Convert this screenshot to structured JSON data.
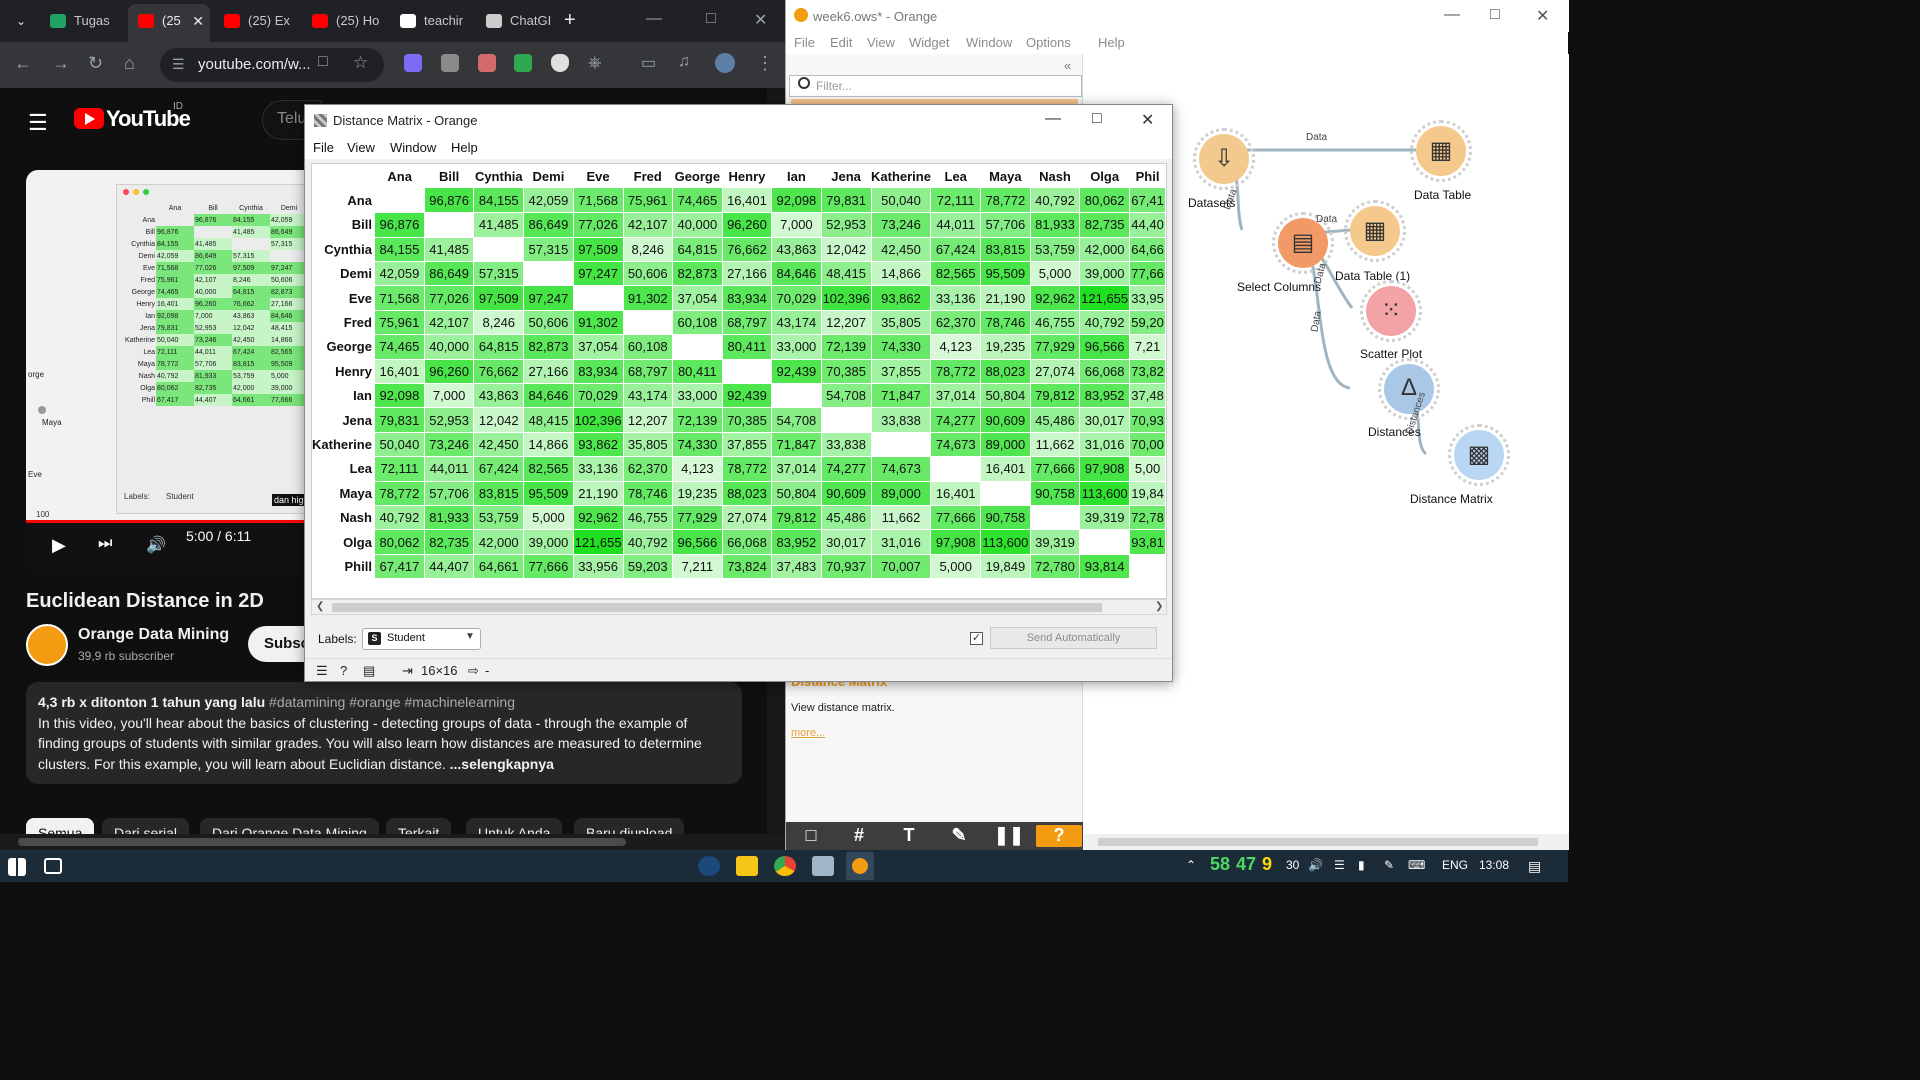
{
  "chrome": {
    "tabs": [
      {
        "label": "Tugas",
        "favicon_color": "#1fa463",
        "active": false
      },
      {
        "label": "(25",
        "favicon_color": "#ff0000",
        "active": true
      },
      {
        "label": "(25) Ex",
        "favicon_color": "#ff0000",
        "active": false
      },
      {
        "label": "(25) Ho",
        "favicon_color": "#ff0000",
        "active": false
      },
      {
        "label": "teachir",
        "favicon_color": "#ffffff",
        "active": false
      },
      {
        "label": "ChatGI",
        "favicon_color": "#cccccc",
        "active": false
      }
    ],
    "url": "youtube.com/w...",
    "new_tab": "+"
  },
  "youtube": {
    "wordmark": "YouTube",
    "country": "ID",
    "search_placeholder": "Telu",
    "video_time": "5:00 / 6:11",
    "video_labels": "Labels:",
    "video_labels_value": "Student",
    "video_side_labels": [
      "orge",
      "Maya",
      "Eve"
    ],
    "video_caption": "dan high",
    "video_scrub_num": "100",
    "title": "Euclidean Distance in 2D",
    "channel": "Orange Data Mining",
    "subscribers": "39,9 rb subscriber",
    "subscribe": "Subsc",
    "desc_meta": "4,3 rb x ditonton  1 tahun yang lalu  ",
    "desc_tags": "#datamining #orange #machinelearning",
    "description": "In this video, you'll hear about the basics of clustering - detecting groups of data - through the example of finding groups of students with similar grades. You will also learn how distances are measured to determine clusters. For this example, you will learn about Euclidian distance.",
    "more": "...selengkapnya",
    "chips": [
      "Semua",
      "Dari serial",
      "Dari Orange Data Mining",
      "Terkait",
      "Untuk Anda",
      "Baru diupload"
    ]
  },
  "orange": {
    "title": "week6.ows* - Orange",
    "menu": [
      "File",
      "Edit",
      "View",
      "Widget",
      "Window",
      "Options",
      "Help"
    ],
    "filter_placeholder": "Filter...",
    "help_heading": "Distance Matrix",
    "help_text": "View distance matrix.",
    "help_more": "more...",
    "widgets": [
      {
        "id": "datasets",
        "label": "Datasets",
        "color": "#f3c98e"
      },
      {
        "id": "data-table",
        "label": "Data Table",
        "color": "#f4c98b"
      },
      {
        "id": "select-columns",
        "label": "Select Columns",
        "color": "#f19a67"
      },
      {
        "id": "data-table-1",
        "label": "Data Table (1)",
        "color": "#f4c98b"
      },
      {
        "id": "scatter-plot",
        "label": "Scatter Plot",
        "color": "#f3a3a6"
      },
      {
        "id": "distances",
        "label": "Distances",
        "color": "#a9c8e8"
      },
      {
        "id": "distance-matrix",
        "label": "Distance Matrix",
        "color": "#b9d6f2"
      }
    ],
    "link_labels": [
      "Data",
      "Data",
      "Data",
      "Data",
      "Data",
      "Distances"
    ]
  },
  "dialog": {
    "title": "Distance Matrix - Orange",
    "menu": [
      "File",
      "View",
      "Window",
      "Help"
    ],
    "labels_label": "Labels:",
    "labels_value": "Student",
    "send_auto": "Send Automatically",
    "auto_checked": true,
    "dims": "16×16",
    "status_dash": "-",
    "headers": [
      "Ana",
      "Bill",
      "Cynthia",
      "Demi",
      "Eve",
      "Fred",
      "George",
      "Henry",
      "Ian",
      "Jena",
      "Katherine",
      "Lea",
      "Maya",
      "Nash",
      "Olga",
      "Phil"
    ],
    "row_headers": [
      "Ana",
      "Bill",
      "Cynthia",
      "Demi",
      "Eve",
      "Fred",
      "George",
      "Henry",
      "Ian",
      "Jena",
      "Katherine",
      "Lea",
      "Maya",
      "Nash",
      "Olga",
      "Phill"
    ],
    "header_display": [
      "Ana",
      "Bill",
      "Cynthia",
      "Demi",
      "Eve",
      "Fred",
      "George",
      "Henry",
      "Ian",
      "Jena",
      "Katherine",
      "Lea",
      "Maya",
      "Nash",
      "Olga",
      "Phil"
    ],
    "row_header_display": [
      "Ana",
      "Bill",
      "Cynthia",
      "Demi",
      "Eve",
      "Fred",
      "George",
      "Henry",
      "Ian",
      "Jena",
      "Katherine",
      "Lea",
      "Maya",
      "Nash",
      "Olga",
      "Phill"
    ],
    "rows": [
      [
        "",
        "96,876",
        "84,155",
        "42,059",
        "71,568",
        "75,961",
        "74,465",
        "16,401",
        "92,098",
        "79,831",
        "50,040",
        "72,111",
        "78,772",
        "40,792",
        "80,062",
        "67,41"
      ],
      [
        "96,876",
        "",
        "41,485",
        "86,649",
        "77,026",
        "42,107",
        "40,000",
        "96,260",
        "7,000",
        "52,953",
        "73,246",
        "44,011",
        "57,706",
        "81,933",
        "82,735",
        "44,40"
      ],
      [
        "84,155",
        "41,485",
        "",
        "57,315",
        "97,509",
        "8,246",
        "64,815",
        "76,662",
        "43,863",
        "12,042",
        "42,450",
        "67,424",
        "83,815",
        "53,759",
        "42,000",
        "64,66"
      ],
      [
        "42,059",
        "86,649",
        "57,315",
        "",
        "97,247",
        "50,606",
        "82,873",
        "27,166",
        "84,646",
        "48,415",
        "14,866",
        "82,565",
        "95,509",
        "5,000",
        "39,000",
        "77,66"
      ],
      [
        "71,568",
        "77,026",
        "97,509",
        "97,247",
        "",
        "91,302",
        "37,054",
        "83,934",
        "70,029",
        "102,396",
        "93,862",
        "33,136",
        "21,190",
        "92,962",
        "121,655",
        "33,95"
      ],
      [
        "75,961",
        "42,107",
        "8,246",
        "50,606",
        "91,302",
        "",
        "60,108",
        "68,797",
        "43,174",
        "12,207",
        "35,805",
        "62,370",
        "78,746",
        "46,755",
        "40,792",
        "59,20"
      ],
      [
        "74,465",
        "40,000",
        "64,815",
        "82,873",
        "37,054",
        "60,108",
        "",
        "80,411",
        "33,000",
        "72,139",
        "74,330",
        "4,123",
        "19,235",
        "77,929",
        "96,566",
        "7,21"
      ],
      [
        "16,401",
        "96,260",
        "76,662",
        "27,166",
        "83,934",
        "68,797",
        "80,411",
        "",
        "92,439",
        "70,385",
        "37,855",
        "78,772",
        "88,023",
        "27,074",
        "66,068",
        "73,82"
      ],
      [
        "92,098",
        "7,000",
        "43,863",
        "84,646",
        "70,029",
        "43,174",
        "33,000",
        "92,439",
        "",
        "54,708",
        "71,847",
        "37,014",
        "50,804",
        "79,812",
        "83,952",
        "37,48"
      ],
      [
        "79,831",
        "52,953",
        "12,042",
        "48,415",
        "102,396",
        "12,207",
        "72,139",
        "70,385",
        "54,708",
        "",
        "33,838",
        "74,277",
        "90,609",
        "45,486",
        "30,017",
        "70,93"
      ],
      [
        "50,040",
        "73,246",
        "42,450",
        "14,866",
        "93,862",
        "35,805",
        "74,330",
        "37,855",
        "71,847",
        "33,838",
        "",
        "74,673",
        "89,000",
        "11,662",
        "31,016",
        "70,00"
      ],
      [
        "72,111",
        "44,011",
        "67,424",
        "82,565",
        "33,136",
        "62,370",
        "4,123",
        "78,772",
        "37,014",
        "74,277",
        "74,673",
        "",
        "16,401",
        "77,666",
        "97,908",
        "5,00"
      ],
      [
        "78,772",
        "57,706",
        "83,815",
        "95,509",
        "21,190",
        "78,746",
        "19,235",
        "88,023",
        "50,804",
        "90,609",
        "89,000",
        "16,401",
        "",
        "90,758",
        "113,600",
        "19,84"
      ],
      [
        "40,792",
        "81,933",
        "53,759",
        "5,000",
        "92,962",
        "46,755",
        "77,929",
        "27,074",
        "79,812",
        "45,486",
        "11,662",
        "77,666",
        "90,758",
        "",
        "39,319",
        "72,78"
      ],
      [
        "80,062",
        "82,735",
        "42,000",
        "39,000",
        "121,655",
        "40,792",
        "96,566",
        "66,068",
        "83,952",
        "30,017",
        "31,016",
        "97,908",
        "113,600",
        "39,319",
        "",
        "93,81"
      ],
      [
        "67,417",
        "44,407",
        "64,661",
        "77,666",
        "33,956",
        "59,203",
        "7,211",
        "73,824",
        "37,483",
        "70,937",
        "70,007",
        "5,000",
        "19,849",
        "72,780",
        "93,814",
        ""
      ]
    ]
  },
  "taskbar": {
    "tray_nums": [
      "58",
      "47",
      "9"
    ],
    "tray_num_colors": [
      "#4cd964",
      "#4cd964",
      "#ffd60a"
    ],
    "temp": "30",
    "lang": "ENG",
    "time": "13:08"
  }
}
